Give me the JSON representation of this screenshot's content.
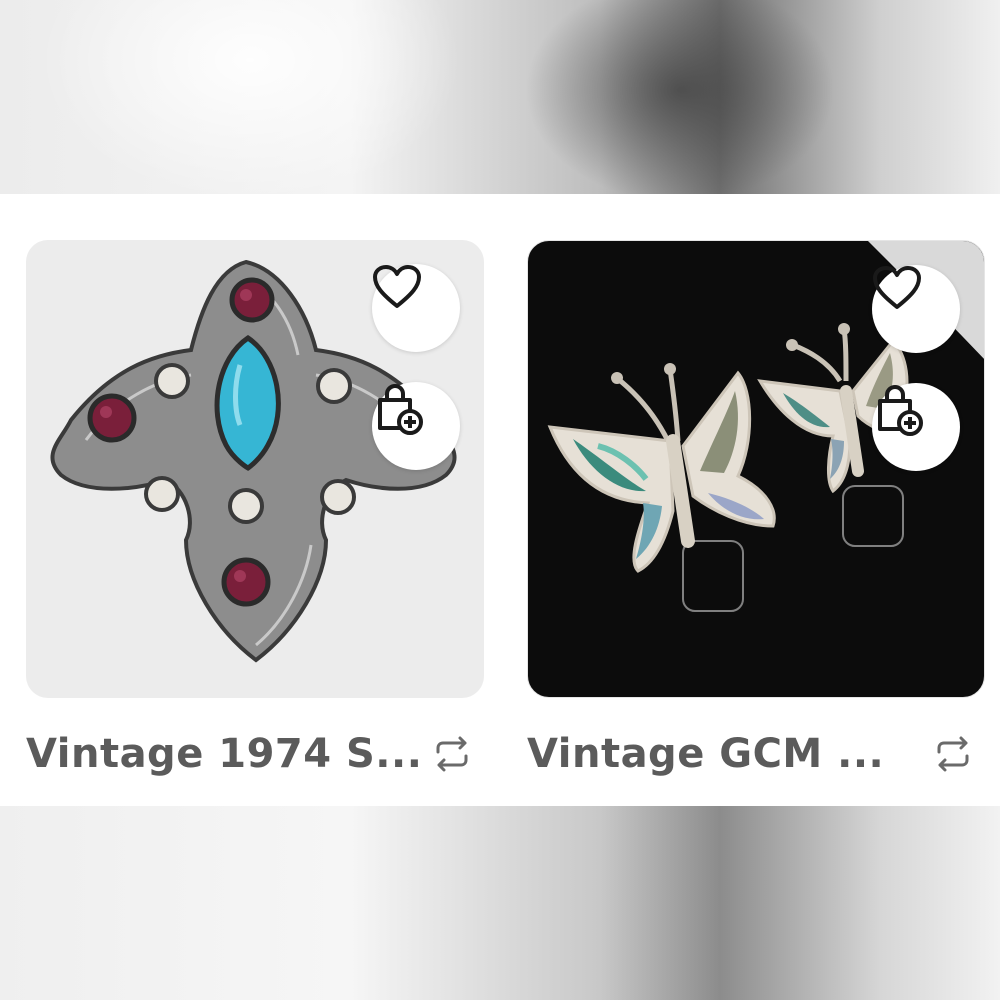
{
  "listings": [
    {
      "title": "Vintage 1974 S...",
      "image": "brooch-photo",
      "icons": {
        "like": "heart-icon",
        "bundle": "bag-plus-icon",
        "share": "repost-icon"
      }
    },
    {
      "title": "Vintage GCM ...",
      "image": "butterfly-earrings-photo",
      "icons": {
        "like": "heart-icon",
        "bundle": "bag-plus-icon",
        "share": "repost-icon"
      }
    }
  ],
  "colors": {
    "title": "#5b5b5b",
    "icon": "#1a1a1a",
    "card_light_bg": "#ececec",
    "card_dark_bg": "#0c0c0c"
  }
}
